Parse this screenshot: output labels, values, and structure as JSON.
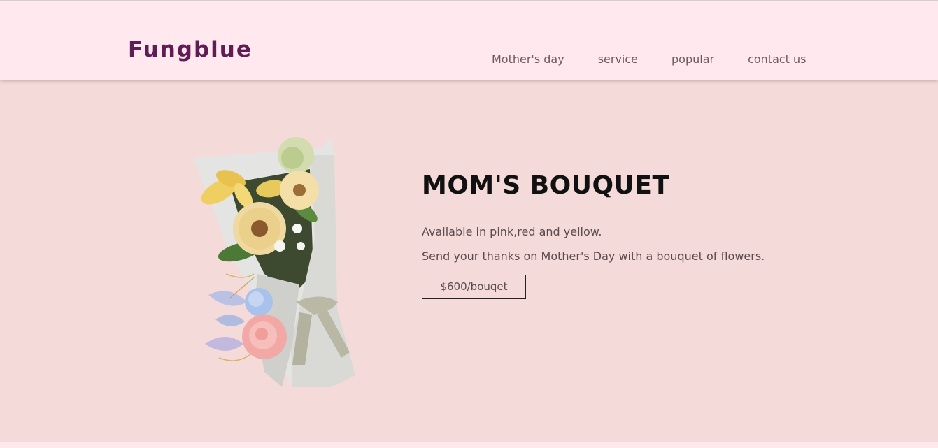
{
  "header": {
    "brand": "Fungblue",
    "nav": [
      "Mother's day",
      "service",
      "popular",
      "contact us"
    ]
  },
  "product": {
    "title": "MOM'S BOUQUET",
    "description_1": "Available in pink,red and yellow.",
    "description_2": "Send your thanks on Mother's Day with a bouquet of flowers.",
    "price_label": "$600/bouqet",
    "image": "bouquet-image"
  },
  "colors": {
    "header_bg": "#ffe9ee",
    "main_bg": "#f4dad8",
    "brand": "#5f1d55",
    "nav_text": "#6b5a5e",
    "heading": "#111111"
  }
}
